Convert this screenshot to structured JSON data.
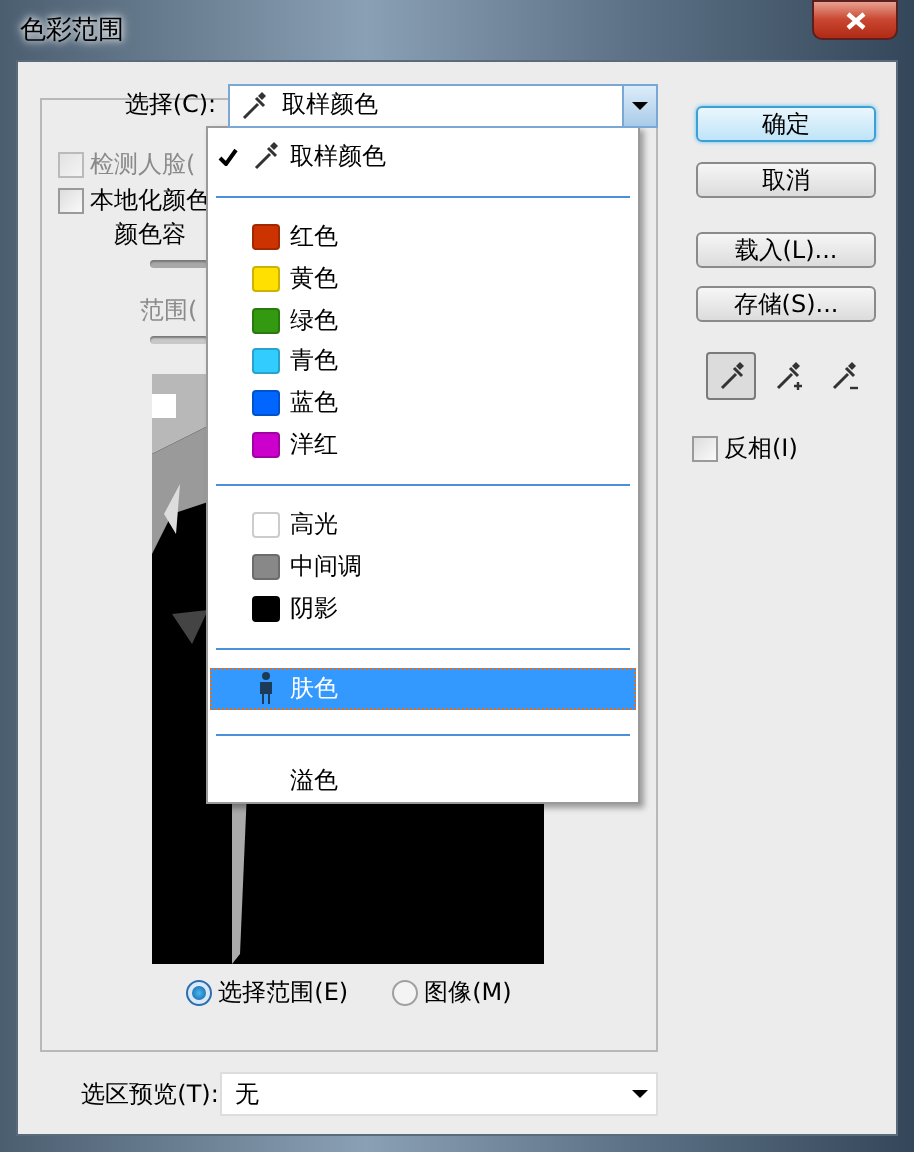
{
  "window": {
    "title": "色彩范围"
  },
  "select": {
    "label": "选择(C):",
    "value": "取样颜色"
  },
  "options": [
    {
      "label": "检测人脸(",
      "checked": false,
      "disabled": true
    },
    {
      "label": "本地化颜色",
      "checked": false,
      "disabled": false
    }
  ],
  "fuzziness": {
    "label": "颜色容"
  },
  "range": {
    "label": "范围(",
    "disabled": true
  },
  "view_modes": [
    {
      "label": "选择范围(E)",
      "selected": true
    },
    {
      "label": "图像(M)",
      "selected": false
    }
  ],
  "selection_preview": {
    "label": "选区预览(T):",
    "value": "无"
  },
  "buttons": [
    {
      "label": "确定",
      "default": true
    },
    {
      "label": "取消",
      "default": false
    },
    {
      "label": "载入(L)...",
      "default": false
    },
    {
      "label": "存储(S)...",
      "default": false
    }
  ],
  "eyedroppers": [
    {
      "kind": "plain",
      "selected": true
    },
    {
      "kind": "plus",
      "selected": false
    },
    {
      "kind": "minus",
      "selected": false
    }
  ],
  "invert": {
    "label": "反相(I)",
    "checked": false
  },
  "menu": {
    "groups": [
      {
        "items": [
          {
            "kind": "eyedropper",
            "label": "取样颜色",
            "checked": true,
            "selected": false
          }
        ]
      },
      {
        "items": [
          {
            "kind": "swatch",
            "label": "红色",
            "color": "#cc3300",
            "checked": false,
            "selected": false
          },
          {
            "kind": "swatch",
            "label": "黄色",
            "color": "#ffe000",
            "checked": false,
            "selected": false
          },
          {
            "kind": "swatch",
            "label": "绿色",
            "color": "#339911",
            "checked": false,
            "selected": false
          },
          {
            "kind": "swatch",
            "label": "青色",
            "color": "#33ccff",
            "checked": false,
            "selected": false
          },
          {
            "kind": "swatch",
            "label": "蓝色",
            "color": "#0066ff",
            "checked": false,
            "selected": false
          },
          {
            "kind": "swatch",
            "label": "洋红",
            "color": "#cc00cc",
            "checked": false,
            "selected": false
          }
        ]
      },
      {
        "items": [
          {
            "kind": "swatch",
            "label": "高光",
            "color": "#ffffff",
            "checked": false,
            "selected": false
          },
          {
            "kind": "swatch",
            "label": "中间调",
            "color": "#888888",
            "checked": false,
            "selected": false
          },
          {
            "kind": "swatch",
            "label": "阴影",
            "color": "#000000",
            "checked": false,
            "selected": false
          }
        ]
      },
      {
        "items": [
          {
            "kind": "person",
            "label": "肤色",
            "checked": false,
            "selected": true
          }
        ]
      },
      {
        "items": [
          {
            "kind": "plain",
            "label": "溢色",
            "checked": false,
            "selected": false
          }
        ]
      }
    ]
  }
}
